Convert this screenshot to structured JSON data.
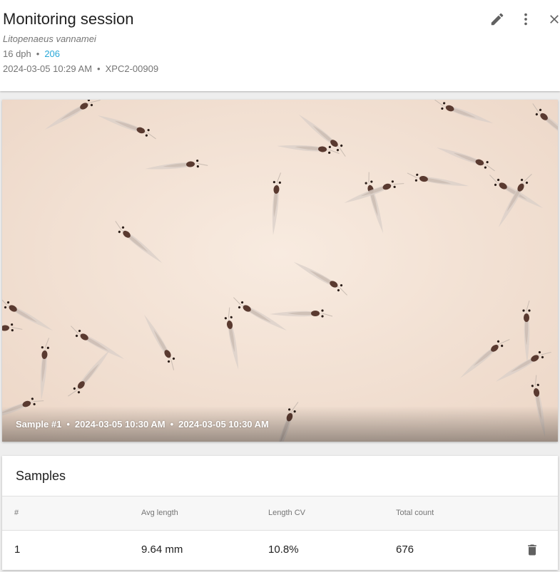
{
  "header": {
    "title": "Monitoring session",
    "species": "Litopenaeus vannamei",
    "age": "16 dph",
    "tank_link": "206",
    "datetime": "2024-03-05 10:29 AM",
    "device_id": "XPC2-00909",
    "separator": "•",
    "icons": [
      "edit-icon",
      "more-vert-icon",
      "close-icon"
    ]
  },
  "image": {
    "caption_sample": "Sample #1",
    "caption_time1": "2024-03-05 10:30 AM",
    "caption_time2": "2024-03-05 10:30 AM"
  },
  "samples": {
    "title": "Samples",
    "columns": [
      "#",
      "Avg length",
      "Length CV",
      "Total count"
    ],
    "rows": [
      {
        "index": "1",
        "avg_length": "9.64 mm",
        "length_cv": "10.8%",
        "total_count": "676"
      }
    ]
  },
  "colors": {
    "link": "#29a8d8",
    "icon": "#616161",
    "photo_background": "#f4e4d8"
  }
}
